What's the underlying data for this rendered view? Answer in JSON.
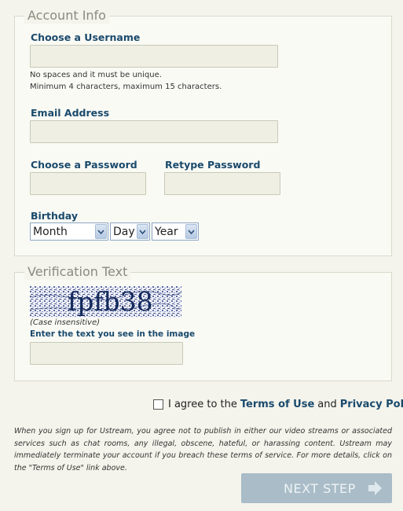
{
  "account": {
    "legend": "Account Info",
    "username": {
      "label": "Choose a Username",
      "value": "",
      "hint_line1": "No spaces and it must be unique.",
      "hint_line2": "Minimum 4 characters, maximum 15 characters."
    },
    "email": {
      "label": "Email Address",
      "value": ""
    },
    "password": {
      "label": "Choose a Password",
      "value": ""
    },
    "retype": {
      "label": "Retype Password",
      "value": ""
    },
    "birthday": {
      "label": "Birthday",
      "month": "Month",
      "day": "Day",
      "year": "Year"
    }
  },
  "verification": {
    "legend": "Verification Text",
    "captcha_text": "fpfb38",
    "case_note": "(Case insensitive)",
    "instruction": "Enter the text you see in the image",
    "value": ""
  },
  "agree": {
    "prefix": "I agree to the",
    "terms": "Terms of Use",
    "and": "and",
    "privacy": "Privacy Policy"
  },
  "legal_text": "When you sign up for Ustream, you agree not to publish in either our video streams or associated services such as chat rooms, any illegal, obscene, hateful, or harassing content. Ustream may immediately terminate your account if you breach these terms of service. For more details, click on the \"Terms of Use\" link above.",
  "next_button": {
    "label": "NEXT STEP"
  },
  "icons": {
    "dropdown": "chevron-down-icon",
    "next": "arrow-right-icon"
  },
  "colors": {
    "label": "#1a4a6c",
    "button": "#a9bcc7",
    "background": "#f4f4ec"
  }
}
